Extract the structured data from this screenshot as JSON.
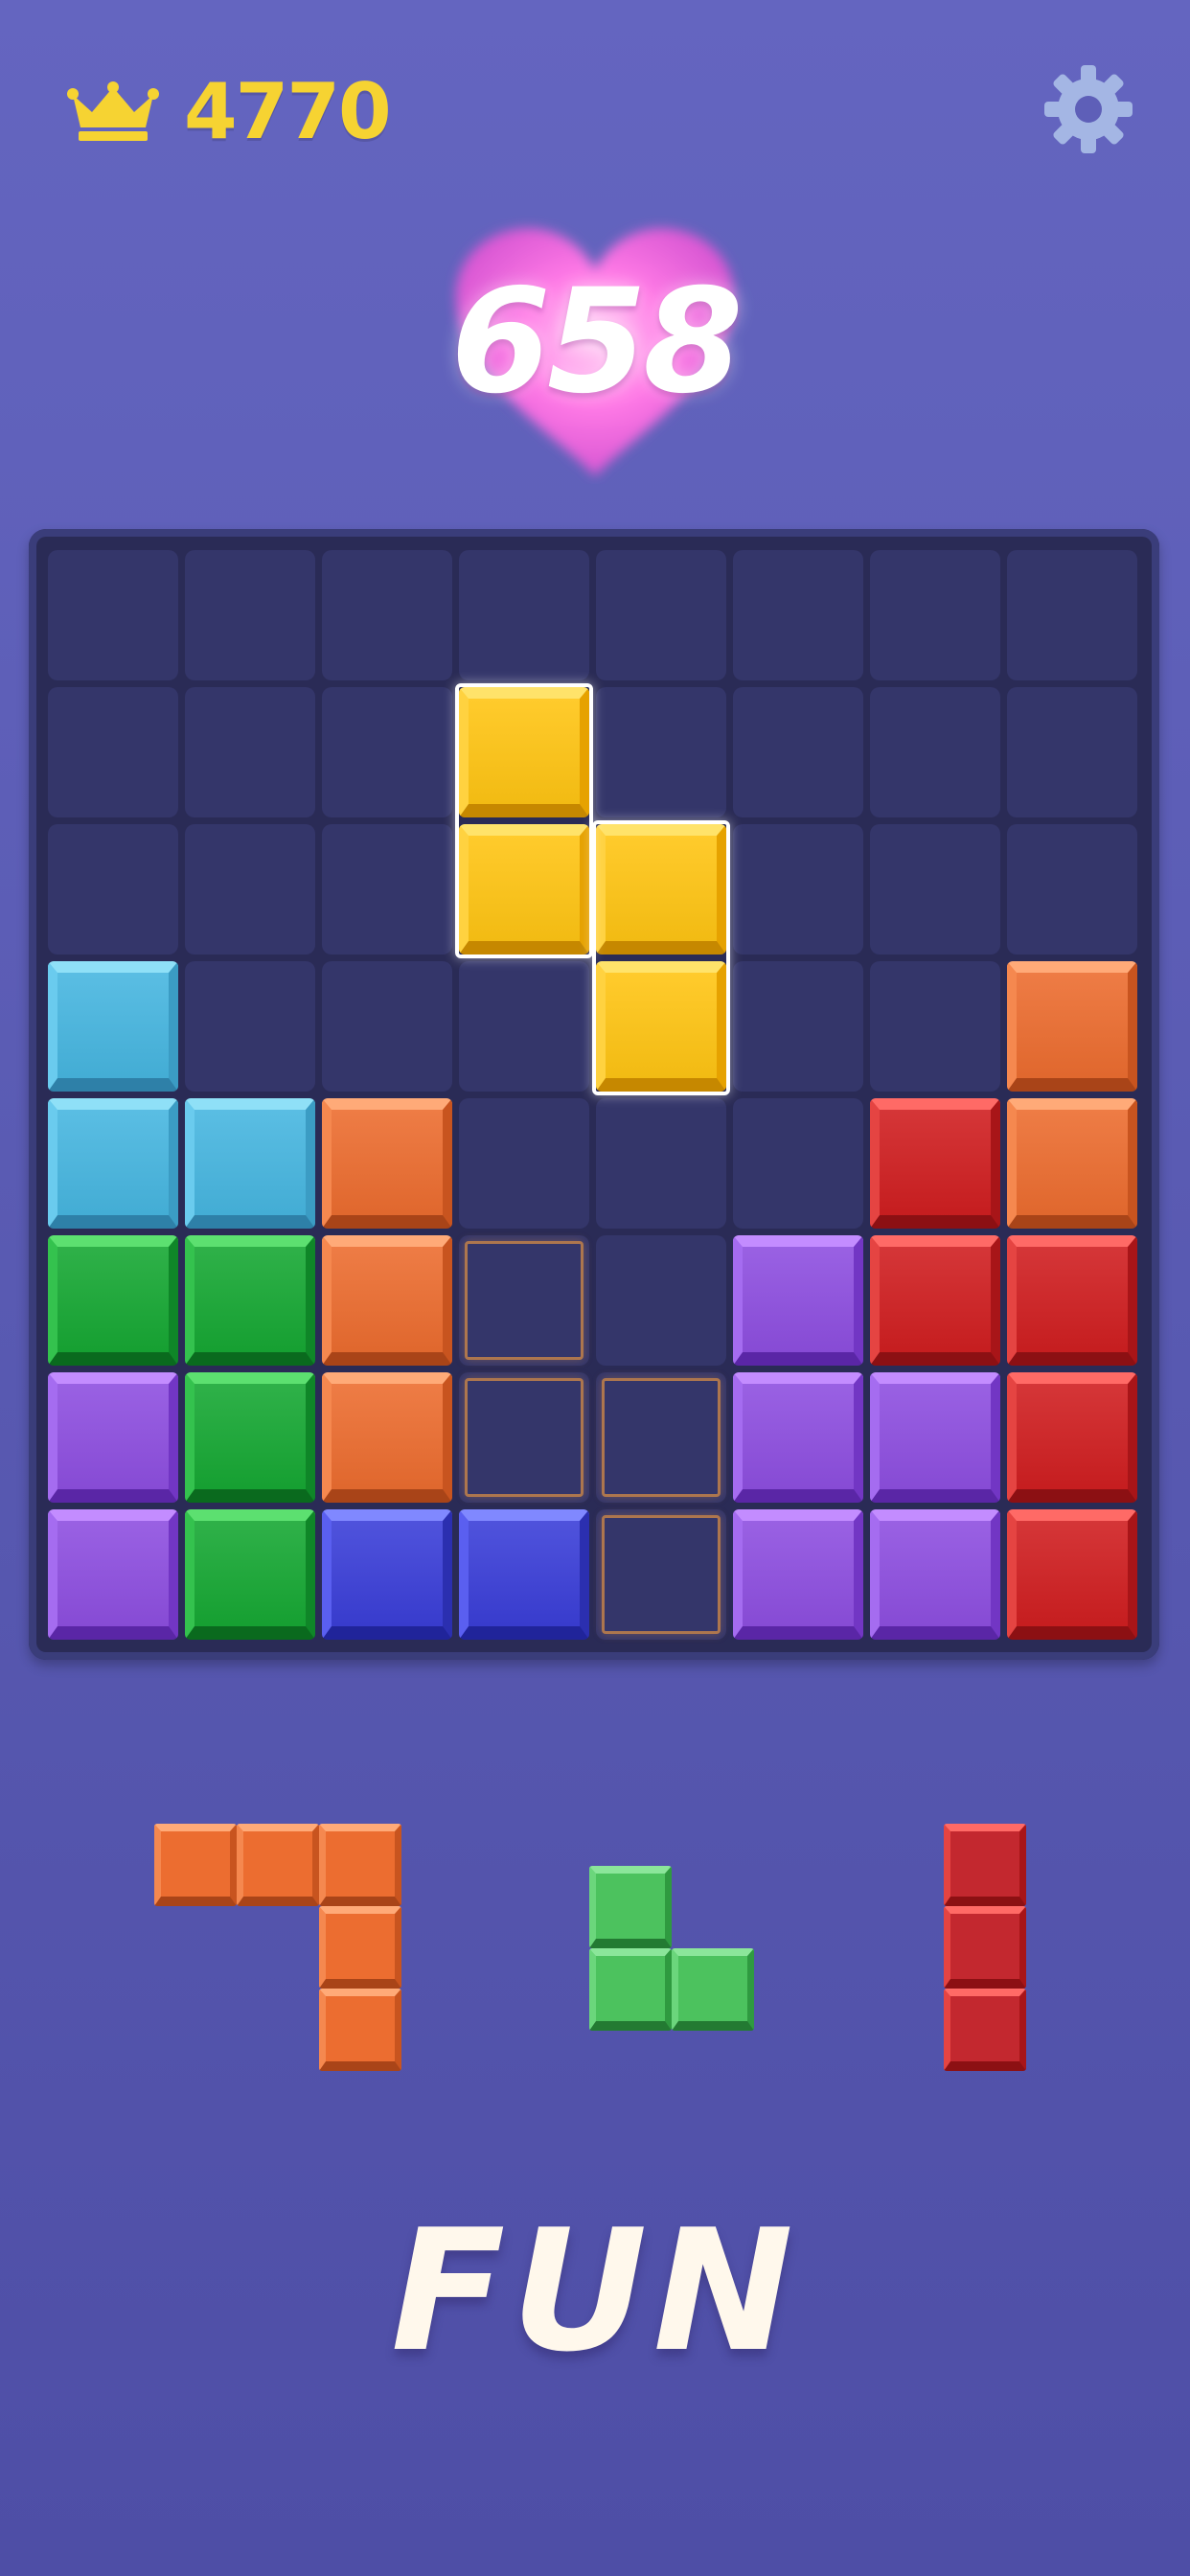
{
  "hud": {
    "best_score": "4770",
    "best_icon": "crown-icon",
    "settings_icon": "gear-icon"
  },
  "score": {
    "current": "658",
    "badge_icon": "heart-icon"
  },
  "colors": {
    "background": "#5d5eb7",
    "board": "#2a2b56",
    "empty_cell": "#34366a",
    "cyan": "#47b6e0",
    "orange": "#ec6d30",
    "red": "#d01f21",
    "green": "#17a834",
    "purple": "#8e4fe0",
    "blue": "#3b3fd8",
    "yellow": "#ffc514",
    "hint": "#d68c46"
  },
  "board": {
    "rows": 8,
    "cols": 8,
    "cells": [
      [
        ".",
        ".",
        ".",
        ".",
        ".",
        ".",
        ".",
        "."
      ],
      [
        ".",
        ".",
        ".",
        ".",
        ".",
        ".",
        ".",
        "."
      ],
      [
        ".",
        ".",
        ".",
        ".",
        ".",
        ".",
        ".",
        "."
      ],
      [
        "cyan",
        ".",
        ".",
        ".",
        ".",
        ".",
        ".",
        "orange"
      ],
      [
        "cyan",
        "cyan",
        "orange",
        ".",
        ".",
        ".",
        "red",
        "orange"
      ],
      [
        "green",
        "green",
        "orange",
        ".",
        ".",
        "purple",
        "red",
        "red"
      ],
      [
        "purple",
        "green",
        "orange",
        ".",
        ".",
        "purple",
        "purple",
        "red"
      ],
      [
        "purple",
        "green",
        "blue",
        "blue",
        ".",
        "purple",
        "purple",
        "red"
      ]
    ],
    "dragging_piece": {
      "color": "yellow",
      "cells": [
        [
          1,
          3
        ],
        [
          2,
          3
        ],
        [
          2,
          4
        ],
        [
          3,
          4
        ]
      ]
    },
    "placement_hint": {
      "cells": [
        [
          5,
          3
        ],
        [
          6,
          3
        ],
        [
          6,
          4
        ],
        [
          7,
          4
        ]
      ]
    }
  },
  "tray": [
    {
      "name": "orange-j-piece",
      "color": "orange",
      "cells": [
        [
          0,
          0
        ],
        [
          0,
          1
        ],
        [
          0,
          2
        ],
        [
          1,
          2
        ],
        [
          2,
          2
        ]
      ]
    },
    {
      "name": "green-l-piece",
      "color": "green",
      "cells": [
        [
          0,
          0
        ],
        [
          1,
          0
        ],
        [
          1,
          1
        ]
      ]
    },
    {
      "name": "red-i-piece",
      "color": "red",
      "cells": [
        [
          0,
          0
        ],
        [
          1,
          0
        ],
        [
          2,
          0
        ]
      ]
    }
  ],
  "tagline": "FUN"
}
